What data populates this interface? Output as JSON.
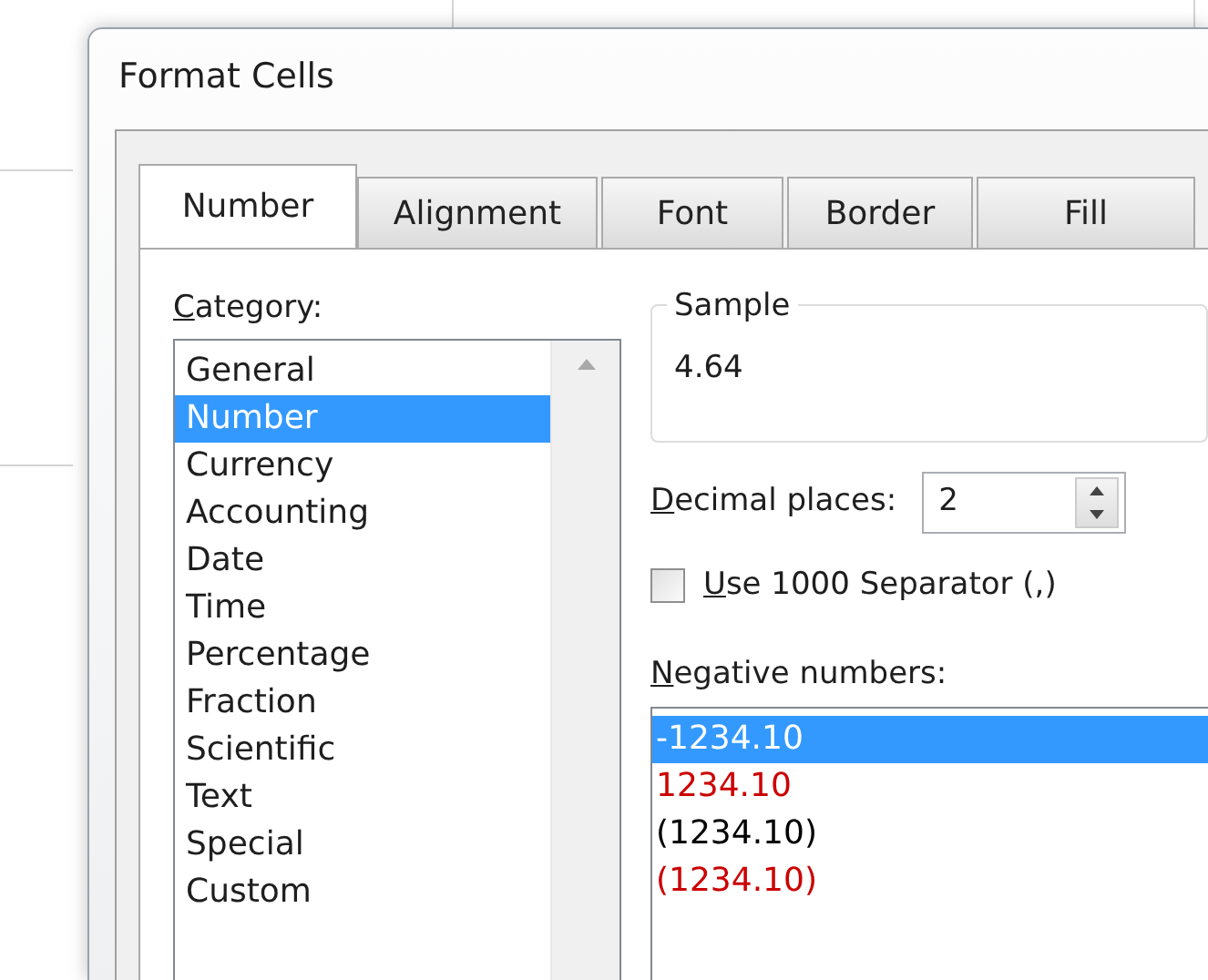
{
  "window": {
    "title": "Format Cells"
  },
  "tabs": [
    {
      "label": "Number",
      "selected": true
    },
    {
      "label": "Alignment",
      "selected": false
    },
    {
      "label": "Font",
      "selected": false
    },
    {
      "label": "Border",
      "selected": false
    },
    {
      "label": "Fill",
      "selected": false
    }
  ],
  "category": {
    "label": "Category:",
    "items": [
      {
        "label": "General",
        "selected": false
      },
      {
        "label": "Number",
        "selected": true
      },
      {
        "label": "Currency",
        "selected": false
      },
      {
        "label": "Accounting",
        "selected": false
      },
      {
        "label": "Date",
        "selected": false
      },
      {
        "label": "Time",
        "selected": false
      },
      {
        "label": "Percentage",
        "selected": false
      },
      {
        "label": "Fraction",
        "selected": false
      },
      {
        "label": "Scientific",
        "selected": false
      },
      {
        "label": "Text",
        "selected": false
      },
      {
        "label": "Special",
        "selected": false
      },
      {
        "label": "Custom",
        "selected": false
      }
    ]
  },
  "sample": {
    "label": "Sample",
    "value": "4.64"
  },
  "decimal_places": {
    "label": "Decimal places:",
    "value": "2"
  },
  "separator": {
    "label": "Use 1000 Separator (,)",
    "checked": false
  },
  "negative_numbers": {
    "label": "Negative numbers:",
    "items": [
      {
        "label": "-1234.10",
        "selected": true
      },
      {
        "label": "1234.10",
        "color": "#cc0000",
        "selected": false
      },
      {
        "label": "(1234.10)",
        "color": "#000000",
        "selected": false
      },
      {
        "label": "(1234.10)",
        "color": "#cc0000",
        "selected": false
      }
    ]
  }
}
